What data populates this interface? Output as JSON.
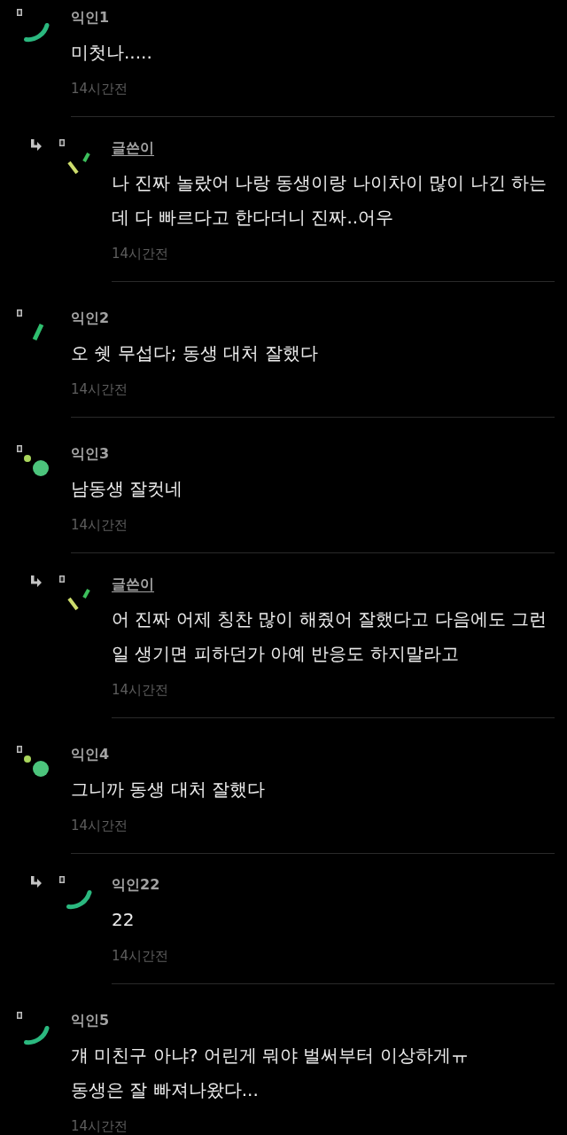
{
  "comments": [
    {
      "kind": "comment",
      "avatar": {
        "kind": "arc"
      },
      "author": false,
      "name": "익인1",
      "body": "미첫나.....",
      "time": "14시간전"
    },
    {
      "kind": "reply",
      "avatar": {
        "kind": "dashes"
      },
      "author": true,
      "name": "글쓴이",
      "body": "나 진짜 놀랐어 나랑 동생이랑 나이차이 많이 나긴 하는데 다 빠르다고 한다더니 진짜..어우",
      "time": "14시간전"
    },
    {
      "kind": "comment",
      "avatar": {
        "kind": "bar"
      },
      "author": false,
      "name": "익인2",
      "body": "오 쉣 무섭다; 동생 대처 잘했다",
      "time": "14시간전"
    },
    {
      "kind": "comment",
      "avatar": {
        "kind": "dots"
      },
      "author": false,
      "name": "익인3",
      "body": "남동생 잘컷네",
      "time": "14시간전"
    },
    {
      "kind": "reply",
      "avatar": {
        "kind": "dashes"
      },
      "author": true,
      "name": "글쓴이",
      "body": "어 진짜 어제 칭찬 많이 해줬어 잘했다고 다음에도 그런 일 생기면 피하던가 아예 반응도 하지말라고",
      "time": "14시간전"
    },
    {
      "kind": "comment",
      "avatar": {
        "kind": "dots"
      },
      "author": false,
      "name": "익인4",
      "body": "그니까 동생 대처 잘했다",
      "time": "14시간전"
    },
    {
      "kind": "reply",
      "avatar": {
        "kind": "arc"
      },
      "author": false,
      "name": "익인22",
      "body": "22",
      "time": "14시간전"
    },
    {
      "kind": "comment",
      "avatar": {
        "kind": "arc"
      },
      "author": false,
      "name": "익인5",
      "body": "걔 미친구 아냐? 어린게 뭐야 벌써부터 이상하게ㅠ\n동생은 잘 빠져나왔다...",
      "time": "14시간전"
    }
  ]
}
